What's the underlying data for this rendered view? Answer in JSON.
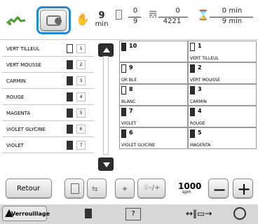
{
  "header": {
    "speed_value": "9",
    "speed_unit": "min",
    "stitch_counter_top": "0",
    "stitch_counter_bottom": "9",
    "stitch_total_top": "0",
    "stitch_total_bottom": "4221",
    "time_top": "0 min",
    "time_bottom": "9 min"
  },
  "left_list": [
    {
      "name": "VERT TILLEUL",
      "num": "1"
    },
    {
      "name": "VERT MOUSSE",
      "num": "2"
    },
    {
      "name": "CARMIN",
      "num": "3"
    },
    {
      "name": "ROUGE",
      "num": "4"
    },
    {
      "name": "MAGENTA",
      "num": "5"
    },
    {
      "name": "VIOLET GLYCINE",
      "num": "6"
    },
    {
      "name": "VIOLET",
      "num": "7"
    }
  ],
  "right_grid": [
    {
      "num": "10",
      "name": ""
    },
    {
      "num": "1",
      "name": "VERT TILLEUL"
    },
    {
      "num": "9",
      "name": "OR BLE"
    },
    {
      "num": "2",
      "name": "VERT MOUSSE"
    },
    {
      "num": "8",
      "name": "BLANC"
    },
    {
      "num": "3",
      "name": "CARMIN"
    },
    {
      "num": "7",
      "name": "VIOLET"
    },
    {
      "num": "4",
      "name": "ROUGE"
    },
    {
      "num": "6",
      "name": "VIOLET GLYCINE"
    },
    {
      "num": "5",
      "name": "MAGENTA"
    }
  ],
  "footer": {
    "back_label": "Retour",
    "speed": "1000",
    "speed_unit": "spm",
    "lock_label": "Verrouillage"
  }
}
